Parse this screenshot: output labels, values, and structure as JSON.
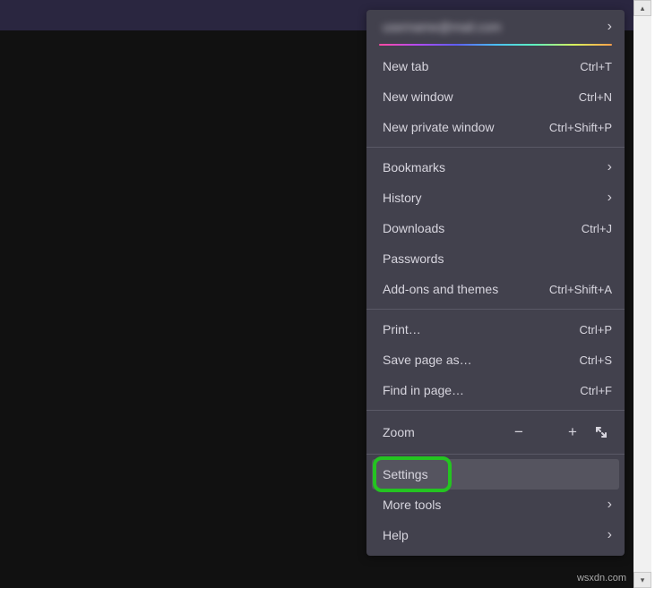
{
  "account": {
    "label": "username@mail.com"
  },
  "menu": {
    "new_tab": {
      "label": "New tab",
      "accel": "Ctrl+T"
    },
    "new_window": {
      "label": "New window",
      "accel": "Ctrl+N"
    },
    "new_private": {
      "label": "New private window",
      "accel": "Ctrl+Shift+P"
    },
    "bookmarks": {
      "label": "Bookmarks"
    },
    "history": {
      "label": "History"
    },
    "downloads": {
      "label": "Downloads",
      "accel": "Ctrl+J"
    },
    "passwords": {
      "label": "Passwords"
    },
    "addons": {
      "label": "Add-ons and themes",
      "accel": "Ctrl+Shift+A"
    },
    "print": {
      "label": "Print…",
      "accel": "Ctrl+P"
    },
    "save_page": {
      "label": "Save page as…",
      "accel": "Ctrl+S"
    },
    "find": {
      "label": "Find in page…",
      "accel": "Ctrl+F"
    },
    "zoom": {
      "label": "Zoom",
      "minus": "−",
      "plus": "+"
    },
    "settings": {
      "label": "Settings"
    },
    "more_tools": {
      "label": "More tools"
    },
    "help": {
      "label": "Help"
    }
  },
  "watermark": "wsxdn.com"
}
